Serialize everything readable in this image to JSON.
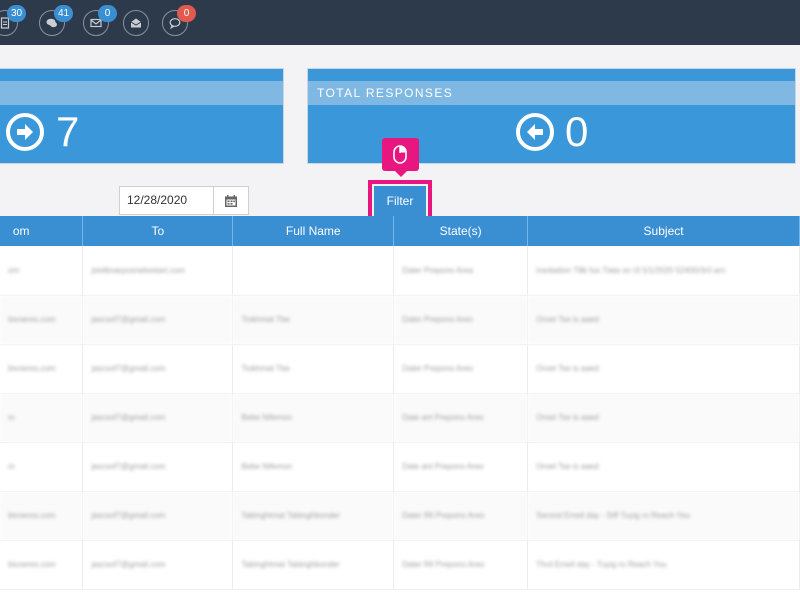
{
  "navbar": {
    "badges": [
      {
        "icon": "document-icon",
        "count": "30",
        "color": "#3a8fd3"
      },
      {
        "icon": "chat-bubbles-icon",
        "count": "41",
        "color": "#3a8fd3"
      },
      {
        "icon": "envelope-icon",
        "count": "0",
        "color": "#3a8fd3"
      },
      {
        "icon": "open-envelope-icon",
        "count": "",
        "color": ""
      },
      {
        "icon": "comment-icon",
        "count": "0",
        "color": "#e05a4e"
      }
    ]
  },
  "cards": {
    "left": {
      "value": "7",
      "icon": "arrow-right-circle-icon"
    },
    "right": {
      "title": "TOTAL RESPONSES",
      "value": "0",
      "icon": "arrow-left-circle-icon"
    }
  },
  "filter": {
    "date_value": "12/28/2020",
    "button_label": "Filter"
  },
  "table": {
    "headers": [
      "om",
      "To",
      "Full Name",
      "State(s)",
      "Subject"
    ],
    "rows": [
      [
        "om",
        "jstelboarposnekestart.com",
        "",
        "Dater Prepono Area",
        "Iravbation T8b fus Tlata on t3 5/1/2020 52400/3r0 arn"
      ],
      [
        "bivoeres.com",
        "jascsof7@gmail.com",
        "Tiokhmat Tbe",
        "Dater Prepono Areo",
        "Oroet Tse is aaed"
      ],
      [
        "bivoeres.com",
        "jascsof7@gmail.com",
        "Tiokhmat Tbe",
        "Dater Prepono Areo",
        "Oroet Tse is aaed"
      ],
      [
        "m",
        "jascsof7@gmail.com",
        "Bebe Nifemon",
        "Date ant Prepono Areo",
        "Oroet Tse is aaed"
      ],
      [
        "m",
        "jascsof7@gmail.com",
        "Bebe Nifemon",
        "Date ant Prepono Areo",
        "Oroet Tse is aaed"
      ],
      [
        "bivoeres.com",
        "jascsof7@gmail.com",
        "Tabinghtmat Tabinghbonder",
        "Dater Rll Prepono Areo",
        "Serond Emeil day - Stff Tuyig ro Reach You"
      ],
      [
        "bivoeres.com",
        "jascsof7@gmail.com",
        "Tabinghtmat Tabinghbonder",
        "Dater Rll Prepono Areo",
        "Thrd Emeil day - Tuyig ro Reach You"
      ]
    ]
  }
}
